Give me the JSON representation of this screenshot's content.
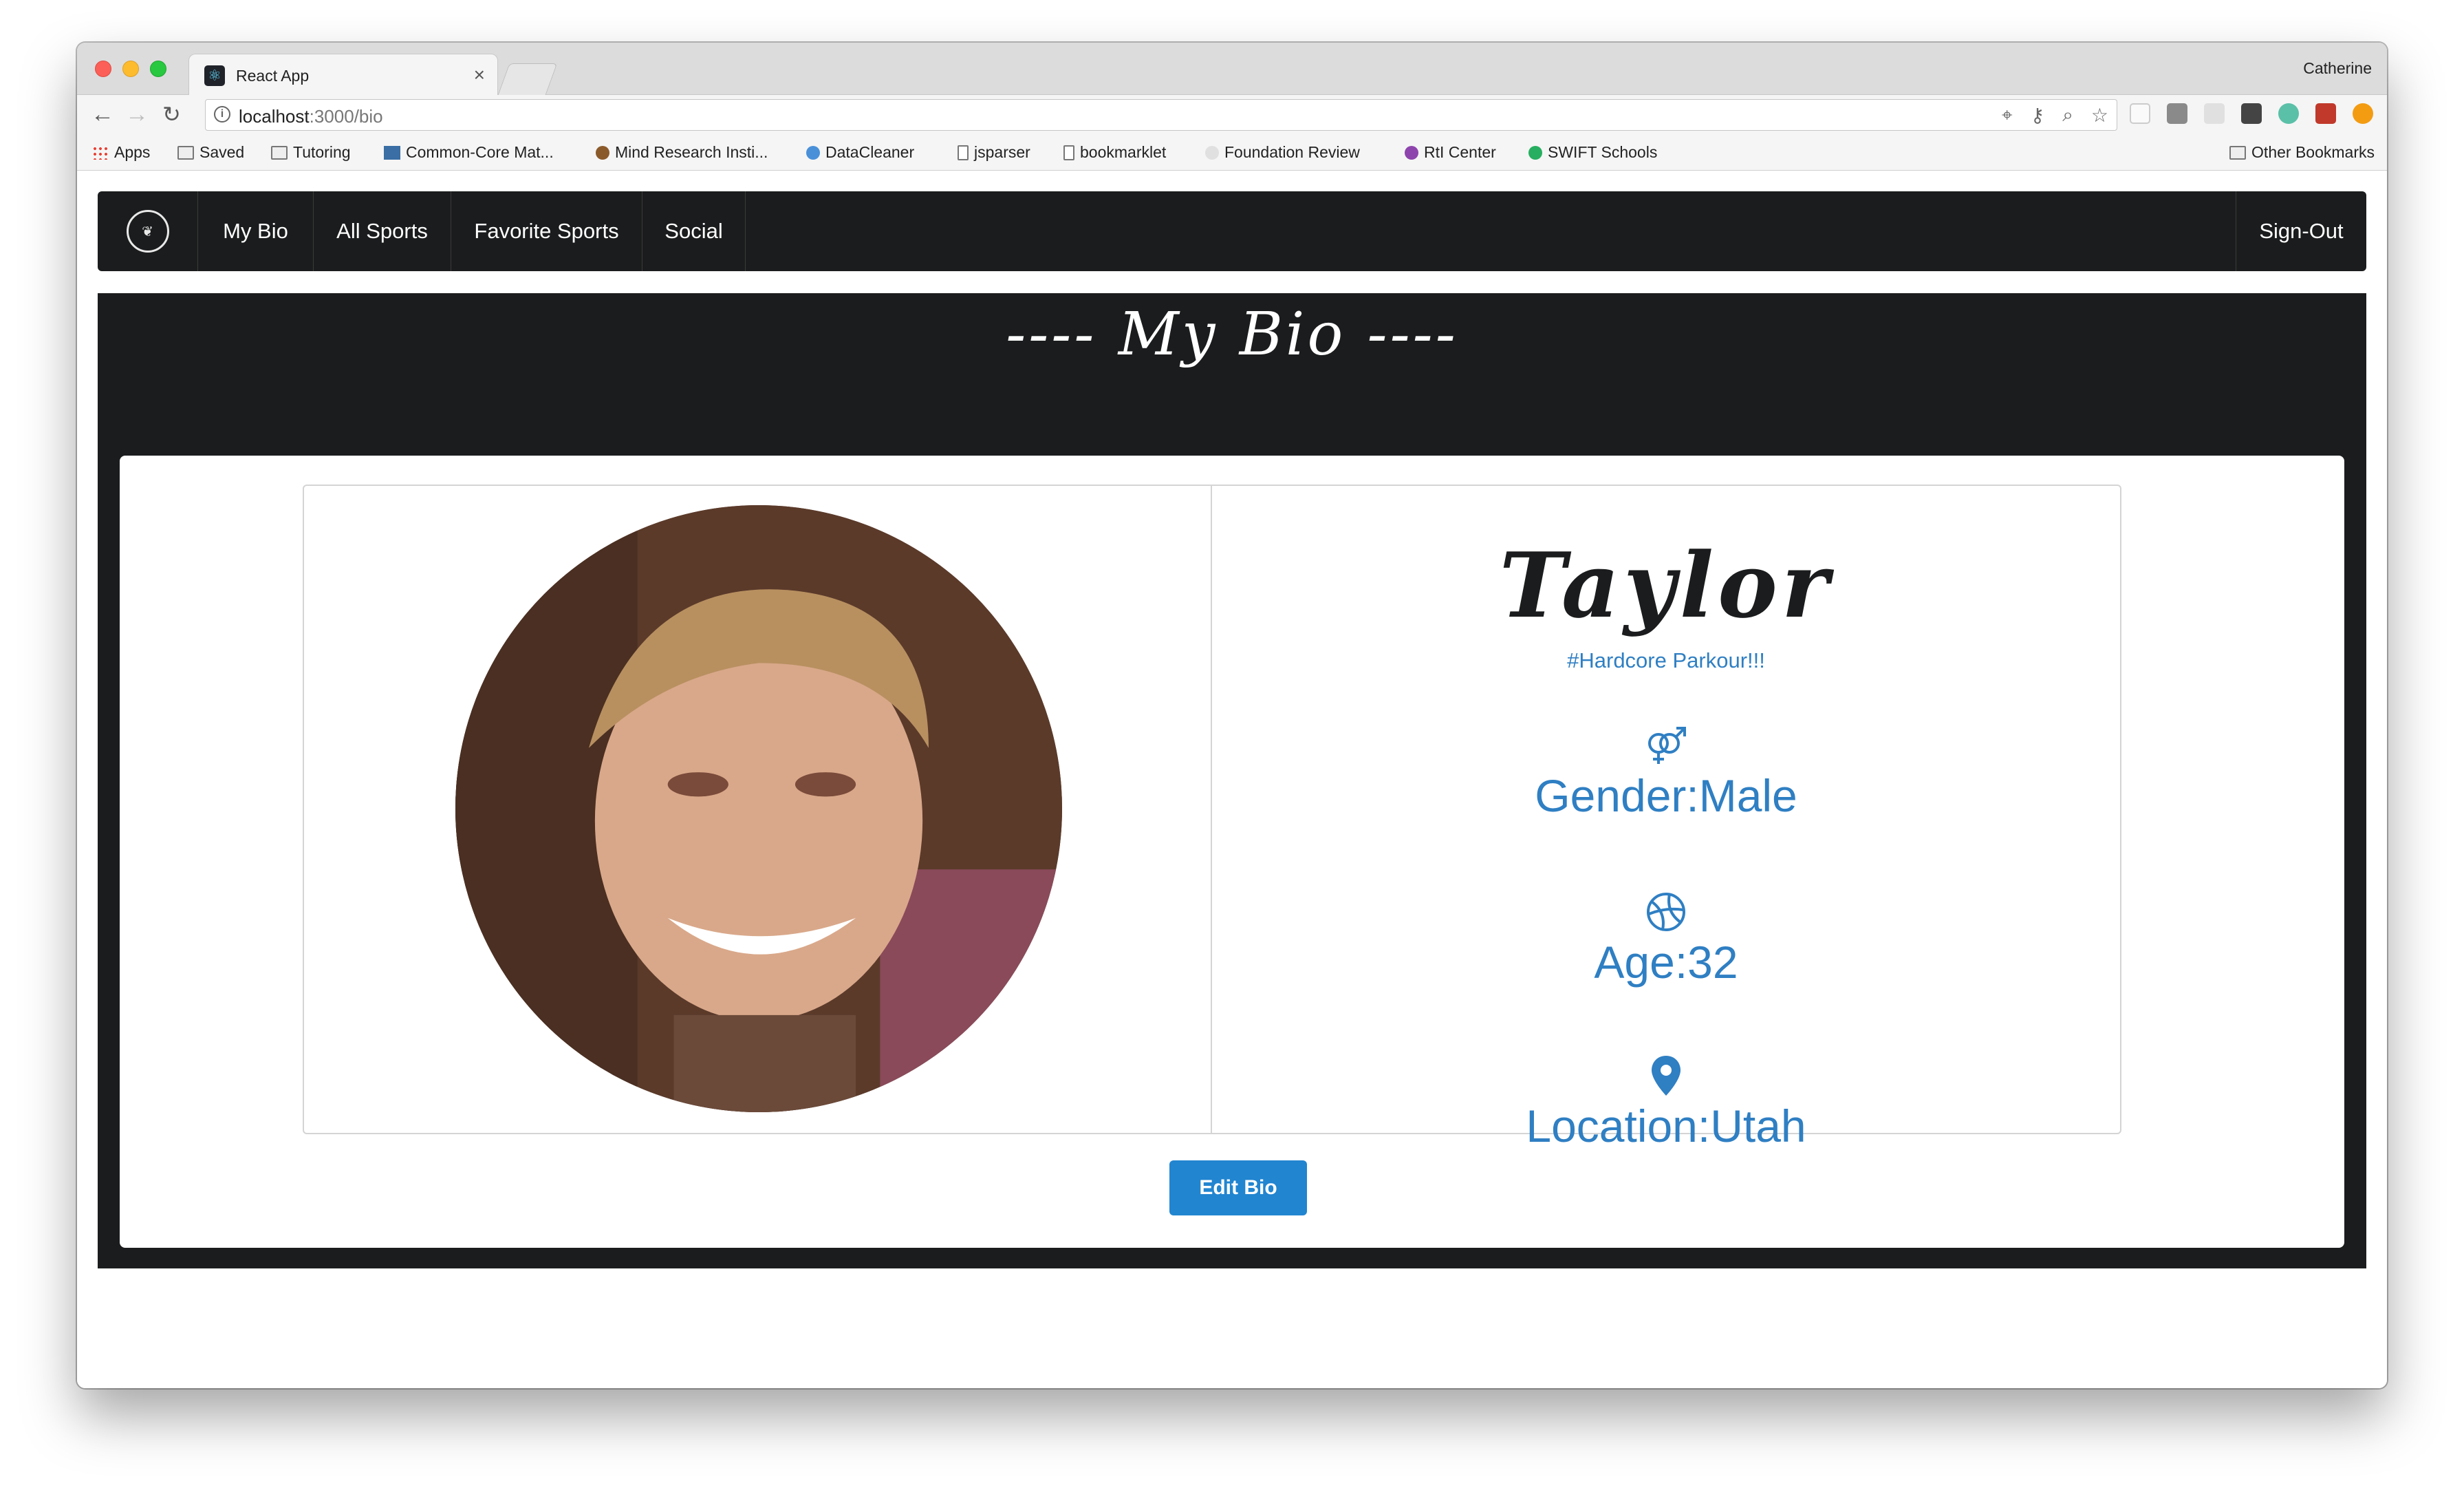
{
  "browser": {
    "tab_title": "React App",
    "tab_close": "×",
    "profile": "Catherine",
    "url_host": "localhost",
    "url_path": ":3000/bio",
    "bookmarks": [
      "Apps",
      "Saved",
      "Tutoring",
      "Common-Core Mat...",
      "Mind Research Insti...",
      "DataCleaner",
      "jsparser",
      "bookmarklet",
      "Foundation Review",
      "RtI Center",
      "SWIFT Schools"
    ],
    "other_bookmarks": "Other Bookmarks"
  },
  "navbar": {
    "items": [
      "My Bio",
      "All Sports",
      "Favorite Sports",
      "Social"
    ],
    "signout": "Sign-Out"
  },
  "bio": {
    "heading": "---- My Bio ----",
    "name": "Taylor",
    "tagline": "#Hardcore Parkour!!!",
    "gender": "Gender:Male",
    "age": "Age:32",
    "location": "Location:Utah",
    "edit_button": "Edit Bio"
  },
  "colors": {
    "accent": "#2185d0",
    "stat_text": "#2f7fc3",
    "nav_bg": "#1b1c1d"
  },
  "icons": {
    "gender": "gender-icon",
    "age": "basketball-icon",
    "location": "map-marker-icon"
  }
}
